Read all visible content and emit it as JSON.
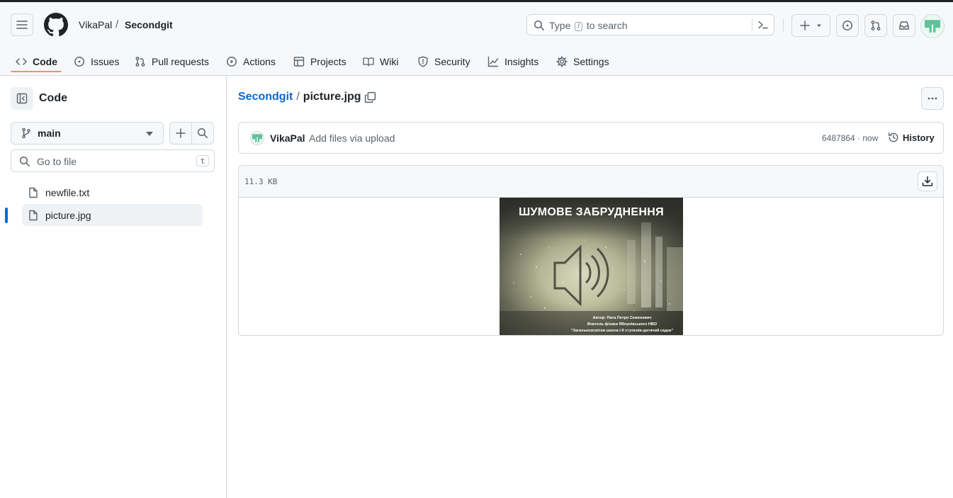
{
  "header": {
    "owner": "VikaPal",
    "separator": "/",
    "repo": "Secondgit",
    "search": {
      "prefix": "Type",
      "key": "/",
      "suffix": "to search"
    }
  },
  "repo_nav": {
    "items": [
      {
        "label": "Code",
        "icon": "code-icon",
        "active": true
      },
      {
        "label": "Issues",
        "icon": "issue-opened-icon"
      },
      {
        "label": "Pull requests",
        "icon": "git-pull-request-icon"
      },
      {
        "label": "Actions",
        "icon": "play-icon"
      },
      {
        "label": "Projects",
        "icon": "table-icon"
      },
      {
        "label": "Wiki",
        "icon": "book-icon"
      },
      {
        "label": "Security",
        "icon": "shield-icon"
      },
      {
        "label": "Insights",
        "icon": "graph-icon"
      },
      {
        "label": "Settings",
        "icon": "gear-icon"
      }
    ]
  },
  "sidebar": {
    "title": "Code",
    "branch": "main",
    "goto_placeholder": "Go to file",
    "goto_key": "t",
    "files": [
      {
        "name": "newfile.txt"
      },
      {
        "name": "picture.jpg",
        "selected": true
      }
    ]
  },
  "path": {
    "repo": "Secondgit",
    "separator": "/",
    "file": "picture.jpg"
  },
  "commit": {
    "author": "VikaPal",
    "message": "Add files via upload",
    "meta": "6487864 · now",
    "history_label": "History"
  },
  "file": {
    "size": "11.3 KB"
  },
  "preview": {
    "title": "ШУМОВЕ ЗАБРУДНЕННЯ",
    "credits": [
      "Автор: Пата Петро Семенович",
      "Вчитель фізики Яблунівського НВО",
      "\"Загальноосвітня школа І-ІІ ступенів-дитячий садок\""
    ]
  },
  "colors": {
    "accent": "#0969da",
    "nav_underline": "#fd8c73",
    "header_bg": "#f6f8fa",
    "border": "#d1d9e0",
    "avatar_green": "#5fc09a"
  }
}
